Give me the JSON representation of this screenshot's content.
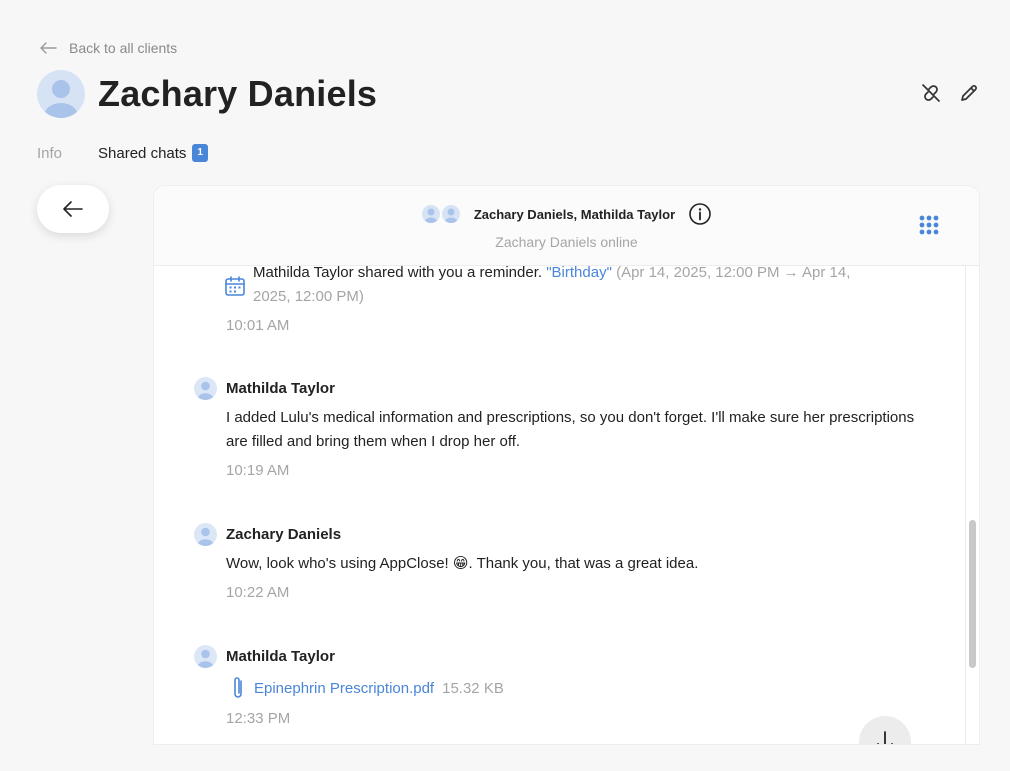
{
  "nav": {
    "back_label": "Back to all clients"
  },
  "client": {
    "name": "Zachary Daniels"
  },
  "tabs": [
    {
      "label": "Info",
      "active": false
    },
    {
      "label": "Shared chats",
      "active": true,
      "badge": "1"
    }
  ],
  "chat": {
    "participants": "Zachary Daniels, Mathilda Taylor",
    "status": "Zachary Daniels online",
    "messages": {
      "reminder": {
        "prefix": "Mathilda Taylor shared with you a reminder.",
        "title": "\"Birthday\"",
        "range": "(Apr 14, 2025, 12:00 PM → Apr 14, 2025, 12:00 PM)",
        "time": "10:01 AM"
      },
      "m1": {
        "sender": "Mathilda Taylor",
        "text": "I added Lulu's medical information and prescriptions, so you don't forget. I'll make sure her prescriptions are filled and bring them when I drop her off.",
        "time": "10:19 AM"
      },
      "m2": {
        "sender": "Zachary Daniels",
        "text": "Wow, look who's using AppClose! 😁. Thank you, that was a great idea.",
        "time": "10:22 AM"
      },
      "m3": {
        "sender": "Mathilda Taylor",
        "file_name": "Epinephrin Prescription.pdf",
        "file_size": "15.32 KB",
        "time": "12:33 PM"
      }
    }
  },
  "colors": {
    "accent": "#4a86d8",
    "muted": "#a5a5a5",
    "background": "#f7f7f8"
  }
}
